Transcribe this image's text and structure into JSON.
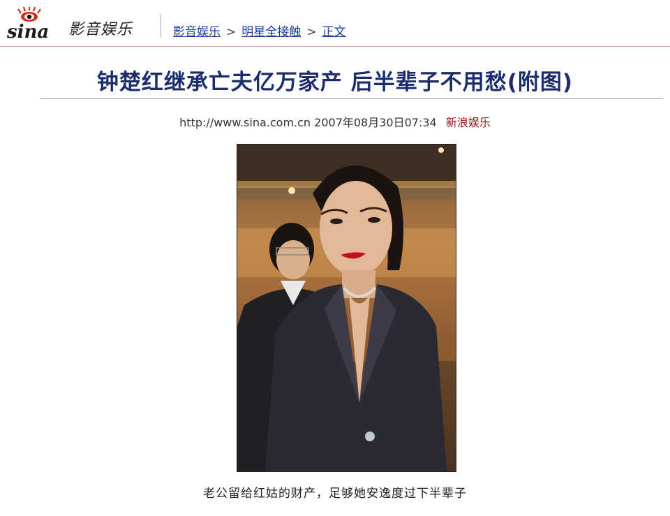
{
  "header": {
    "logo_text": "sina",
    "channel_name": "影音娱乐",
    "breadcrumb": [
      {
        "label": "影音娱乐"
      },
      {
        "label": "明星全接触"
      },
      {
        "label": "正文"
      }
    ],
    "separator": ">"
  },
  "article": {
    "title": "钟楚红继承亡夫亿万家产 后半辈子不用愁(附图)",
    "url": "http://www.sina.com.cn",
    "datetime": "2007年08月30日07:34",
    "source": "新浪娱乐",
    "photo_caption": "老公留给红姑的财产，足够她安逸度过下半辈子"
  },
  "colors": {
    "title": "#1c2d6e",
    "link": "#1a3b9c",
    "source": "#9b1a1a",
    "logo_red": "#d62a1e"
  }
}
